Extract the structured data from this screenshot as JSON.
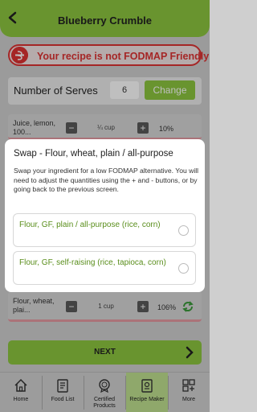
{
  "header": {
    "title": "Blueberry Crumble"
  },
  "warning": {
    "text": "Your recipe is not FODMAP Friendly"
  },
  "serves": {
    "label": "Number of Serves",
    "value": "6",
    "button": "Change"
  },
  "rows": [
    {
      "name": "Juice, lemon, 100...",
      "quantity": "¼ cup",
      "percent": "10%"
    },
    {
      "name": "Flour, wheat, plai...",
      "quantity": "1 cup",
      "percent": "106%"
    }
  ],
  "modal": {
    "title": "Swap - Flour, wheat, plain / all-purpose",
    "body": "Swap your ingredient for a low FODMAP alternative. You will need to adjust the quantities using the + and - buttons, or by going back to the previous screen.",
    "options": [
      "Flour, GF, plain / all-purpose (rice, corn)",
      "Flour, GF, self-raising (rice, tapioca, corn)"
    ]
  },
  "next": {
    "label": "NEXT"
  },
  "nav": [
    {
      "label": "Home",
      "icon": "home-icon"
    },
    {
      "label": "Food List",
      "icon": "food-list-icon"
    },
    {
      "label": "Certified Products",
      "icon": "certified-icon"
    },
    {
      "label": "Recipe Maker",
      "icon": "recipe-icon",
      "active": true
    },
    {
      "label": "More",
      "icon": "more-icon"
    }
  ],
  "colors": {
    "accent": "#8cc63f",
    "danger": "#dd3333",
    "option_text": "#5a8e1c"
  }
}
